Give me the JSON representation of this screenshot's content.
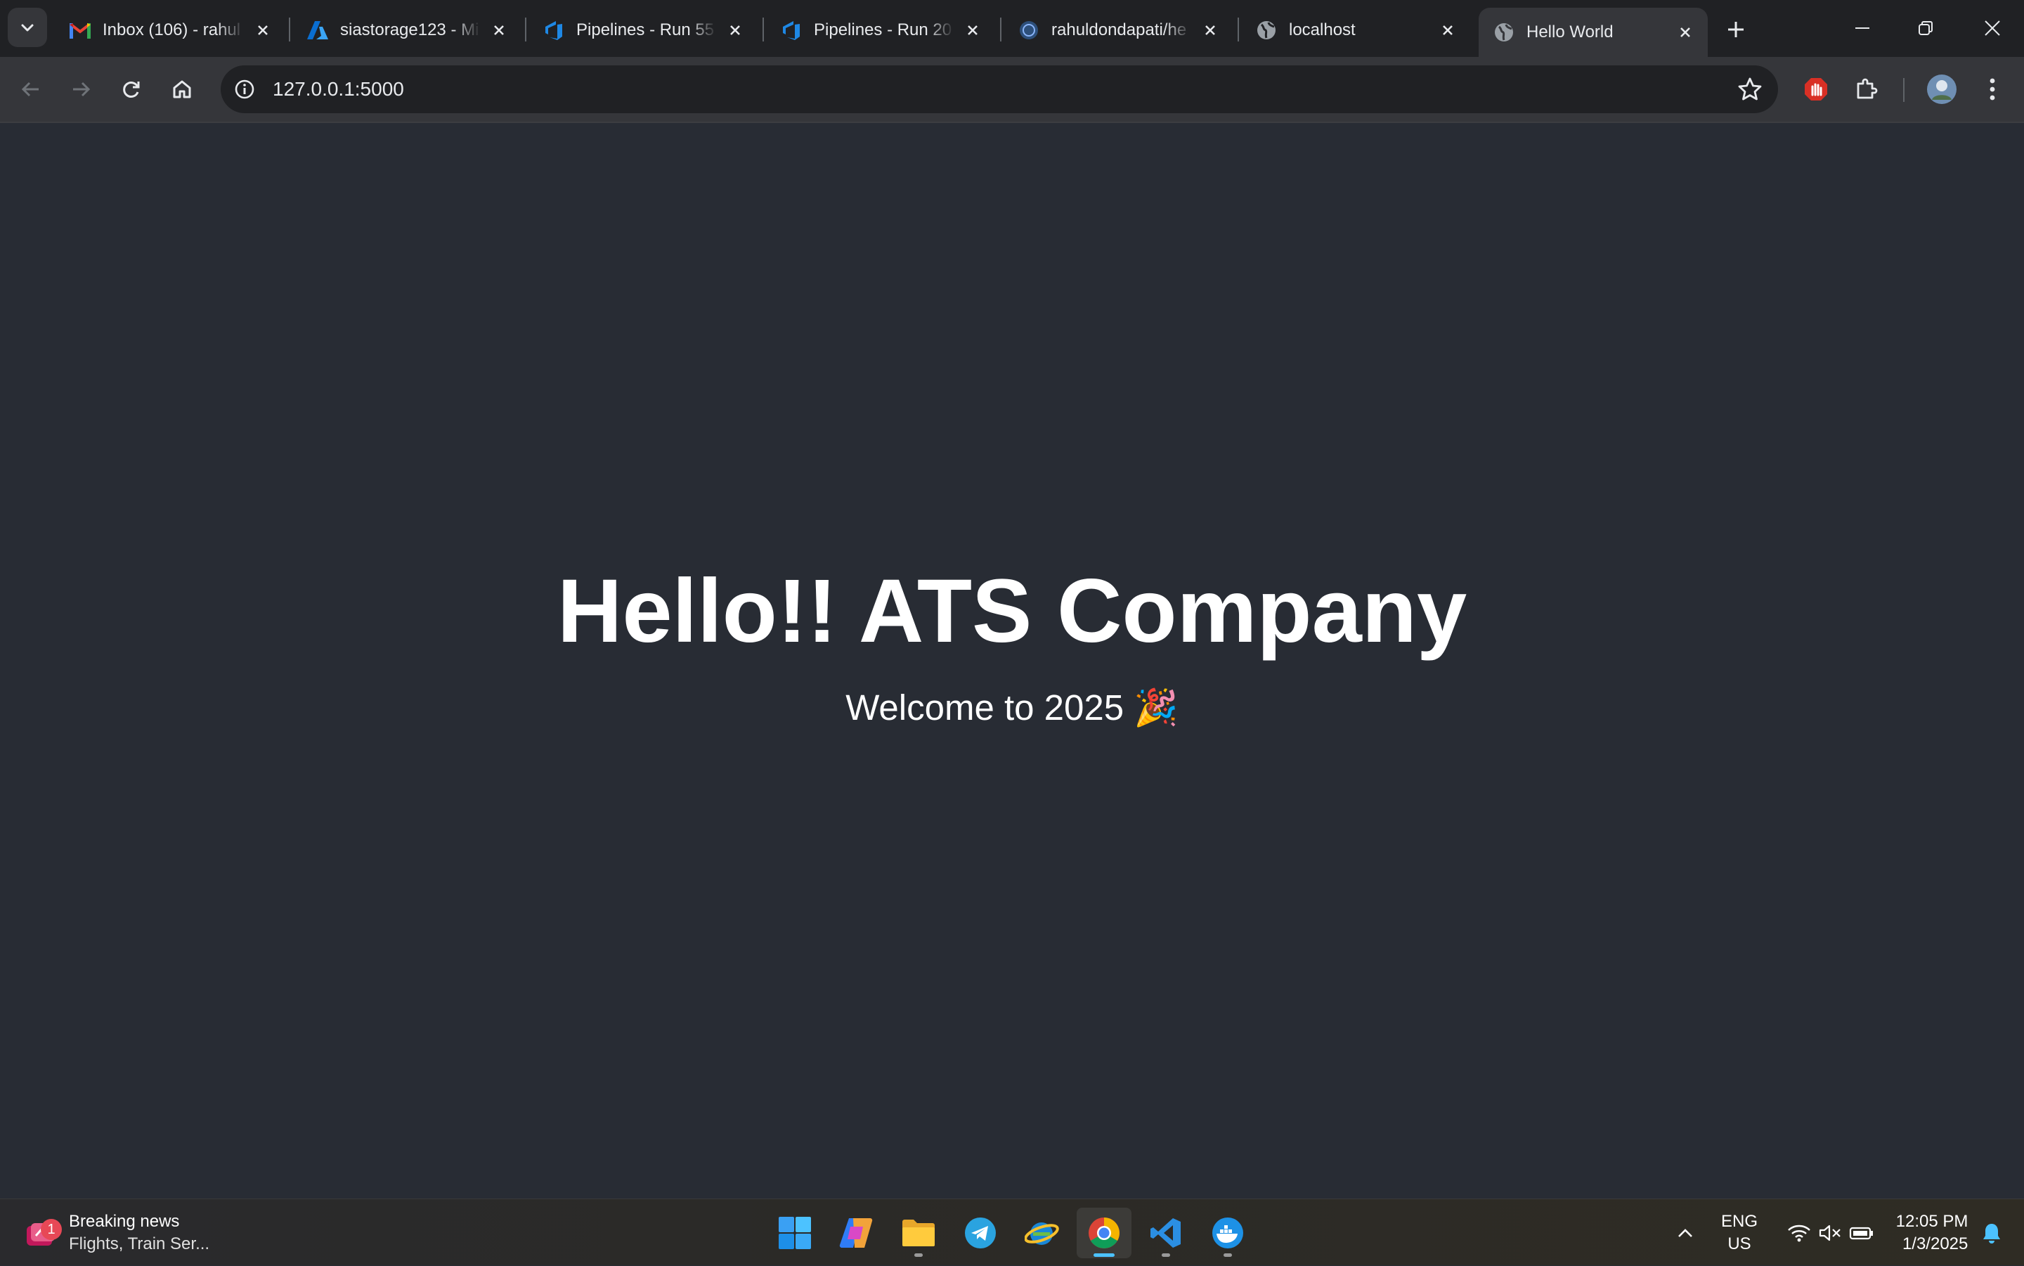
{
  "tabs": [
    {
      "title": "Inbox (106) - rahul",
      "icon": "gmail-icon",
      "active": false
    },
    {
      "title": "siastorage123 - Mi",
      "icon": "azure-icon",
      "active": false
    },
    {
      "title": "Pipelines - Run 55",
      "icon": "azure-devops-icon",
      "active": false
    },
    {
      "title": "Pipelines - Run 20",
      "icon": "azure-devops-icon",
      "active": false
    },
    {
      "title": "rahuldondapati/he",
      "icon": "github-icon",
      "active": false
    },
    {
      "title": "localhost",
      "icon": "globe-icon",
      "active": false
    },
    {
      "title": "Hello World",
      "icon": "globe-icon",
      "active": true
    }
  ],
  "address_bar": {
    "url": "127.0.0.1:5000"
  },
  "page": {
    "heading": "Hello!! ATS Company",
    "subheading": "Welcome to 2025 🎉"
  },
  "taskbar": {
    "news": {
      "title": "Breaking news",
      "subtitle": "Flights, Train Ser...",
      "badge": "1"
    },
    "apps": [
      "windows-start-icon",
      "copilot-icon",
      "file-explorer-icon",
      "telegram-icon",
      "ie-icon",
      "chrome-icon",
      "vscode-icon",
      "docker-icon"
    ],
    "language": {
      "line1": "ENG",
      "line2": "US"
    },
    "clock": {
      "time": "12:05 PM",
      "date": "1/3/2025"
    }
  },
  "colors": {
    "page_background": "#282c34",
    "tabstrip": "#202124",
    "toolbar": "#35363a",
    "accent": "#4cc2ff"
  }
}
